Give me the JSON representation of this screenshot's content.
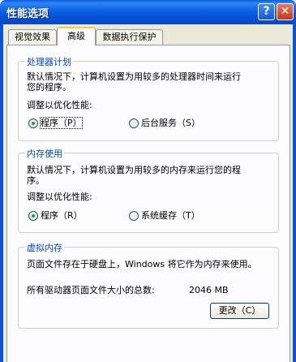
{
  "window": {
    "title": "性能选项",
    "help_glyph": "?",
    "close_glyph": "✕"
  },
  "tabs": [
    {
      "label": "视觉效果"
    },
    {
      "label": "高级"
    },
    {
      "label": "数据执行保护"
    }
  ],
  "processor": {
    "legend": "处理器计划",
    "desc_line1": "默认情况下，计算机设置为用较多的处理器时间来运行",
    "desc_line2": "您的程序。",
    "adjust_label": "调整以优化性能:",
    "option_programs": "程序（P）",
    "option_background": "后台服务（S）",
    "selected": "programs"
  },
  "memory": {
    "legend": "内存使用",
    "desc_line1": "默认情况下，计算机设置为用较多的内存来运行您的程",
    "desc_line2": "序。",
    "adjust_label": "调整以优化性能:",
    "option_programs": "程序（R）",
    "option_cache": "系统缓存（T）",
    "selected": "programs"
  },
  "virtual_memory": {
    "legend": "虚拟内存",
    "desc": "页面文件存在于硬盘上，Windows 将它作为内存来使用。",
    "total_label": "所有驱动器页面文件大小的总数:",
    "total_value": "2046 MB",
    "change_button": "更改（C）"
  }
}
